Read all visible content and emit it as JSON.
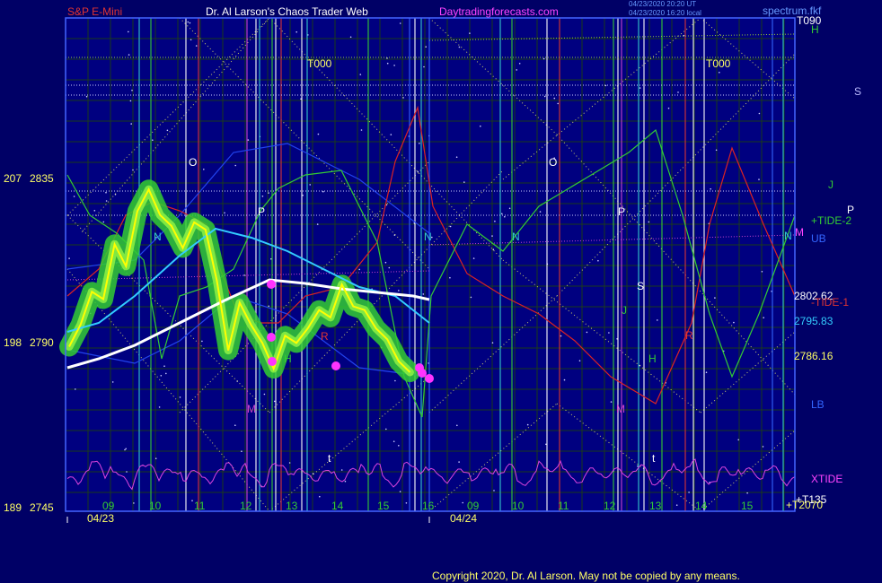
{
  "header": {
    "symbol": "S&P E-Mini",
    "title": "Dr. Al Larson's Chaos Trader Web",
    "site": "Daytradingforecasts.com",
    "timestamp1": "04/23/2020 20:20 UT",
    "timestamp2": "04/23/2020 16:20 local",
    "tag": "spectrum.fkf"
  },
  "y_axis_labels": [
    {
      "a": "207",
      "b": "2835"
    },
    {
      "a": "198",
      "b": "2790"
    },
    {
      "a": "189",
      "b": "2745"
    }
  ],
  "right_labels": {
    "t090": "T090",
    "h": "H",
    "s": "S",
    "j": "J",
    "p": "P",
    "tide2": "+TIDE-2",
    "m": "M",
    "ub": "UB",
    "n": "N",
    "v1": "2802.62",
    "tide1": "-TIDE-1",
    "v2": "2795.83",
    "v3": "2786.16",
    "lb": "LB",
    "xtide": "XTIDE",
    "t135": "+T135",
    "t2070": "+T2070"
  },
  "planet_labels": {
    "t000a": "T000",
    "t000b": "T000",
    "o1": "O",
    "o2": "O",
    "p1": "P",
    "p2": "P",
    "n1": "N",
    "n2": "N",
    "n3": "N",
    "h1": "H",
    "h2": "H",
    "j1": "J",
    "s1": "S",
    "m1": "M",
    "m2": "M",
    "r1": "R",
    "r2": "R",
    "t1": "t",
    "t2": "t"
  },
  "x_hours": [
    "09",
    "10",
    "11",
    "12",
    "13",
    "14",
    "15",
    "16",
    "09",
    "10",
    "11",
    "12",
    "13",
    "14",
    "15"
  ],
  "x_dates": [
    "04/23",
    "04/24"
  ],
  "footer": {
    "copyright": "Copyright 2020, Dr. Al Larson. May not be copied by any means."
  },
  "colors": {
    "background": "#000066",
    "plot_bg": "#000080",
    "price": "#ffff00",
    "price_glow": "#33cc33",
    "avg_fast": "#33ccff",
    "avg_slow": "#ffffff",
    "tide_red": "#dd2222",
    "tide_green": "#33cc33",
    "xtide": "#dd44dd",
    "band": "#2244ee"
  },
  "chart_data": {
    "type": "line",
    "title": "S&P E-Mini",
    "ylim": [
      2745,
      2850
    ],
    "x_ticks": [
      "09",
      "10",
      "11",
      "12",
      "13",
      "14",
      "15",
      "16"
    ],
    "dates": [
      "04/23",
      "04/24"
    ],
    "series": [
      {
        "name": "S&P E-Mini",
        "x": [
          0,
          0.25,
          0.5,
          0.75,
          1,
          1.25,
          1.5,
          1.75,
          2,
          2.25,
          2.5,
          2.75,
          3,
          3.25,
          3.5,
          3.75,
          4,
          4.25,
          4.5,
          4.75,
          5,
          5.25,
          5.5,
          5.75,
          6,
          6.25,
          6.5,
          6.75,
          7,
          7.25,
          7.5
        ],
        "values": [
          2790,
          2796,
          2805,
          2803,
          2818,
          2812,
          2827,
          2833,
          2826,
          2823,
          2817,
          2824,
          2822,
          2808,
          2789,
          2802,
          2796,
          2791,
          2784,
          2793,
          2791,
          2795,
          2800,
          2798,
          2807,
          2801,
          2800,
          2795,
          2792,
          2786,
          2783
        ]
      },
      {
        "name": "+TIDE-2",
        "values": [
          2815,
          2808,
          2820,
          2815,
          2826,
          2824,
          2818,
          2810,
          2805,
          2797,
          2792,
          2801,
          2826,
          2828,
          2806,
          2790,
          2777,
          2786,
          2825,
          2818,
          2821,
          2827,
          2835,
          2846,
          2822,
          2804,
          2823,
          2812
        ]
      },
      {
        "name": "-TIDE-1",
        "values": [
          2802,
          2812,
          2816,
          2830,
          2834,
          2815,
          2803,
          2798,
          2822,
          2832,
          2810,
          2806,
          2805,
          2823,
          2845,
          2826,
          2817,
          2810,
          2800,
          2794,
          2787,
          2779,
          2788,
          2800,
          2824,
          2841,
          2817,
          2802
        ]
      },
      {
        "name": "XTIDE"
      }
    ],
    "levels": [
      2802.62,
      2795.83,
      2786.16
    ]
  }
}
